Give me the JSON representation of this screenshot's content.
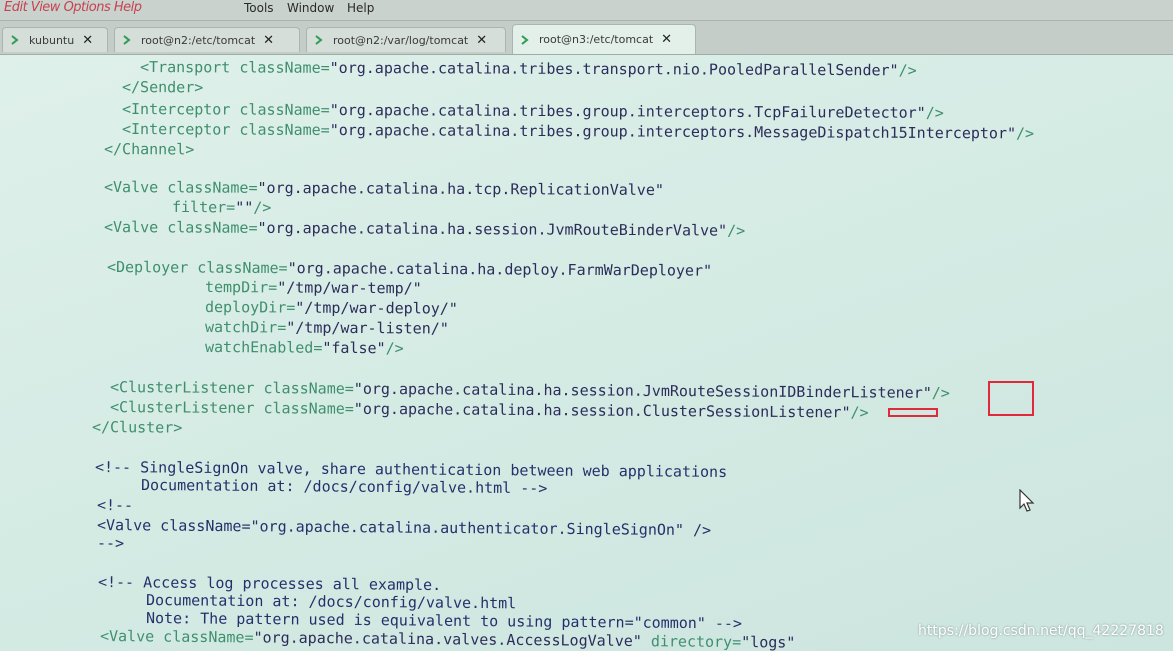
{
  "menubar": {
    "scribble": "Edit View Options Help",
    "items": [
      "Tools",
      "Window",
      "Help"
    ]
  },
  "tabs": [
    {
      "label": "kubuntu",
      "active": false
    },
    {
      "label": "root@n2:/etc/tomcat",
      "active": false
    },
    {
      "label": "root@n2:/var/log/tomcat",
      "active": false
    },
    {
      "label": "root@n3:/etc/tomcat",
      "active": true
    }
  ],
  "terminal": {
    "lines": [
      {
        "parts": [
          [
            "tag",
            "<Transport "
          ],
          [
            "attr",
            "className="
          ],
          [
            "val",
            "\"org.apache.catalina.tribes.transport.nio.PooledParallelSender\""
          ],
          [
            "tag",
            "/>"
          ]
        ]
      },
      {
        "parts": [
          [
            "tag",
            "</Sender>"
          ]
        ]
      },
      {
        "parts": [
          [
            "tag",
            "<Interceptor "
          ],
          [
            "attr",
            "className="
          ],
          [
            "val",
            "\"org.apache.catalina.tribes.group.interceptors.TcpFailureDetector\""
          ],
          [
            "tag",
            "/>"
          ]
        ]
      },
      {
        "parts": [
          [
            "tag",
            "<Interceptor "
          ],
          [
            "attr",
            "className="
          ],
          [
            "val",
            "\"org.apache.catalina.tribes.group.interceptors.MessageDispatch15Interceptor\""
          ],
          [
            "tag",
            "/>"
          ]
        ]
      },
      {
        "parts": [
          [
            "tag",
            "</Channel>"
          ]
        ]
      },
      {
        "parts": []
      },
      {
        "parts": [
          [
            "tag",
            "<Valve "
          ],
          [
            "attr",
            "className="
          ],
          [
            "val",
            "\"org.apache.catalina.ha.tcp.ReplicationValve\""
          ]
        ]
      },
      {
        "parts": [
          [
            "attr",
            "filter="
          ],
          [
            "val",
            "\"\""
          ],
          [
            "tag",
            "/>"
          ]
        ]
      },
      {
        "parts": [
          [
            "tag",
            "<Valve "
          ],
          [
            "attr",
            "className="
          ],
          [
            "val",
            "\"org.apache.catalina.ha.session.JvmRouteBinderValve\""
          ],
          [
            "tag",
            "/>"
          ]
        ]
      },
      {
        "parts": []
      },
      {
        "parts": [
          [
            "tag",
            "<Deployer "
          ],
          [
            "attr",
            "className="
          ],
          [
            "val",
            "\"org.apache.catalina.ha.deploy.FarmWarDeployer\""
          ]
        ]
      },
      {
        "parts": [
          [
            "attr",
            "tempDir="
          ],
          [
            "val",
            "\"/tmp/war-temp/\""
          ]
        ]
      },
      {
        "parts": [
          [
            "attr",
            "deployDir="
          ],
          [
            "val",
            "\"/tmp/war-deploy/\""
          ]
        ]
      },
      {
        "parts": [
          [
            "attr",
            "watchDir="
          ],
          [
            "val",
            "\"/tmp/war-listen/\""
          ]
        ]
      },
      {
        "parts": [
          [
            "attr",
            "watchEnabled="
          ],
          [
            "val",
            "\"false\""
          ],
          [
            "tag",
            "/>"
          ]
        ]
      },
      {
        "parts": []
      },
      {
        "parts": [
          [
            "tag",
            "<ClusterListener "
          ],
          [
            "attr",
            "className="
          ],
          [
            "val",
            "\"org.apache.catalina.ha.session.JvmRouteSessionIDBinderListener\""
          ],
          [
            "tag",
            "/>"
          ]
        ]
      },
      {
        "parts": [
          [
            "tag",
            "<ClusterListener "
          ],
          [
            "attr",
            "className="
          ],
          [
            "val",
            "\"org.apache.catalina.ha.session.ClusterSessionListener\""
          ],
          [
            "tag",
            "/>"
          ]
        ]
      },
      {
        "parts": [
          [
            "tag",
            "</Cluster>"
          ]
        ]
      },
      {
        "parts": []
      },
      {
        "parts": [
          [
            "cmt",
            "<!-- SingleSignOn valve, share authentication between web applications"
          ]
        ]
      },
      {
        "parts": [
          [
            "cmt",
            "Documentation at: /docs/config/valve.html -->"
          ]
        ]
      },
      {
        "parts": [
          [
            "cmt",
            "<!--"
          ]
        ]
      },
      {
        "parts": [
          [
            "cmt",
            "<Valve className=\"org.apache.catalina.authenticator.SingleSignOn\" />"
          ]
        ]
      },
      {
        "parts": [
          [
            "cmt",
            "-->"
          ]
        ]
      },
      {
        "parts": []
      },
      {
        "parts": [
          [
            "cmt",
            "<!-- Access log processes all example."
          ]
        ]
      },
      {
        "parts": [
          [
            "cmt",
            "Documentation at: /docs/config/valve.html"
          ]
        ]
      },
      {
        "parts": [
          [
            "cmt",
            "Note: The pattern used is equivalent to using pattern=\"common\" -->"
          ]
        ]
      },
      {
        "parts": [
          [
            "tag",
            "<Valve "
          ],
          [
            "attr",
            "className="
          ],
          [
            "val",
            "\"org.apache.catalina.valves.AccessLogValve\""
          ],
          [
            "attr",
            " directory="
          ],
          [
            "val",
            "\"logs\""
          ]
        ]
      }
    ]
  },
  "watermark": "https://blog.csdn.net/qq_42227818",
  "colors": {
    "highlight": "#e0293a",
    "tag": "#3f8f6e",
    "value": "#2c2c5a",
    "comment": "#24306b"
  }
}
